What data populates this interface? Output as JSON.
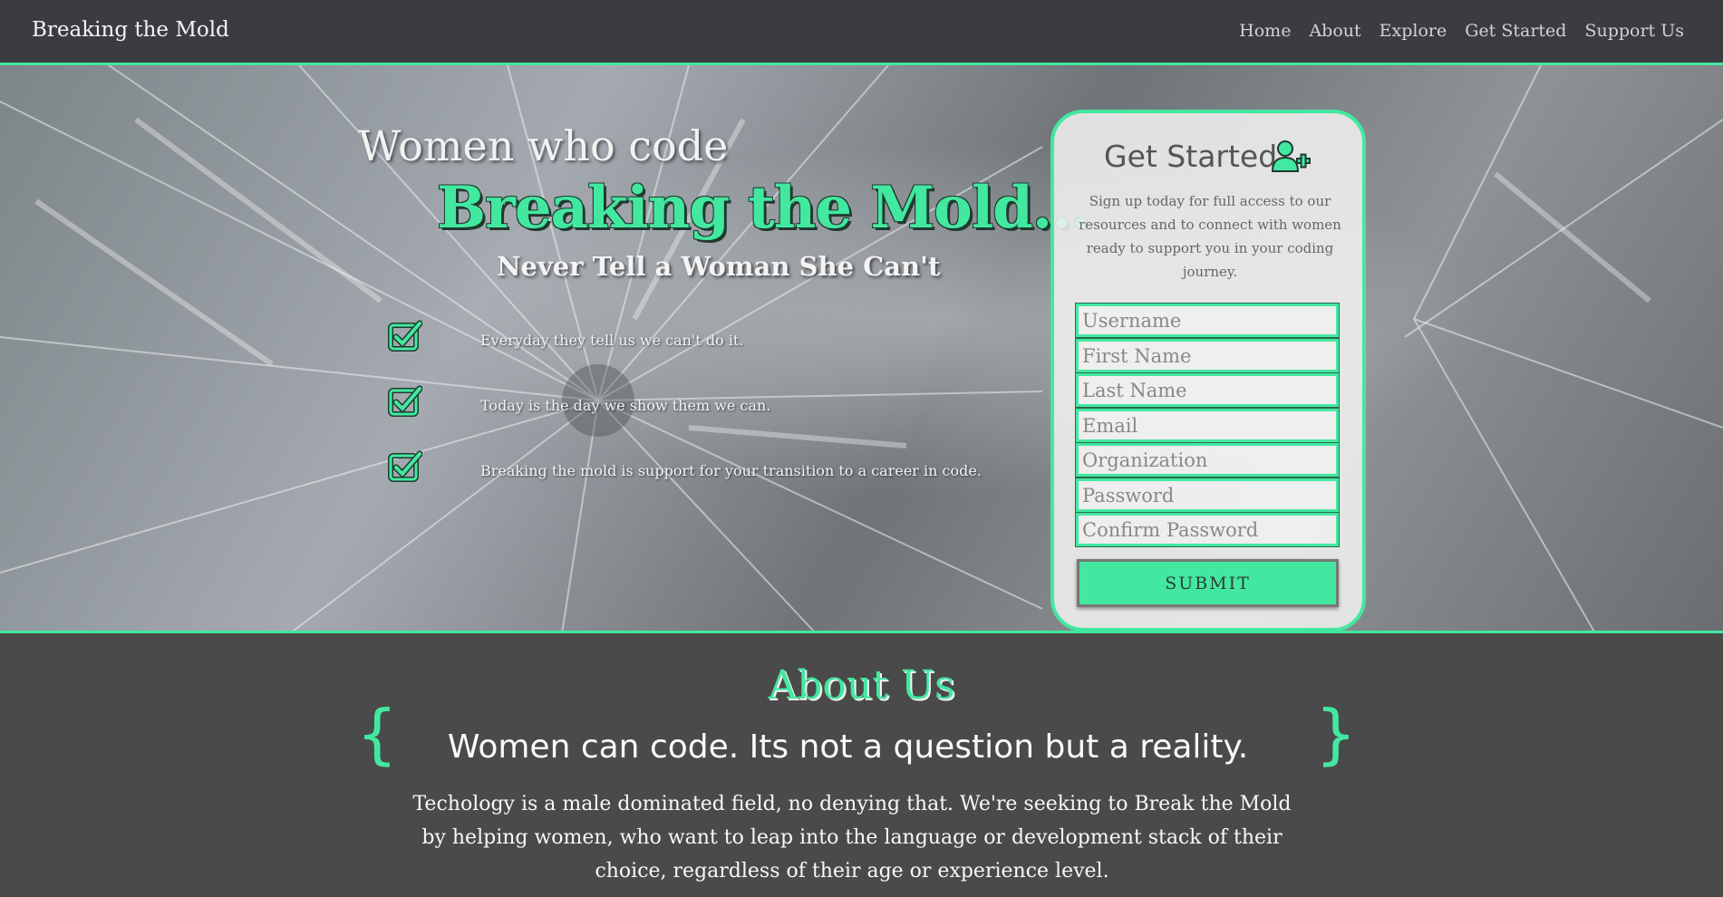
{
  "nav": {
    "brand": "Breaking the Mold",
    "links": [
      "Home",
      "About",
      "Explore",
      "Get Started",
      "Support Us"
    ]
  },
  "hero": {
    "subtitle": "Women who code",
    "title": "Breaking the Mold...",
    "tagline": "Never Tell a Woman She Can't",
    "checklist": [
      "Everyday they tell us we can't do it.",
      "Today is the day we show them we can.",
      "Breaking the mold is support for your transition to a career in code."
    ]
  },
  "signup": {
    "title": "Get Started",
    "description": "Sign up today for full access to our resources and to connect with women ready to support you in your coding journey.",
    "placeholders": {
      "username": "Username",
      "first_name": "First Name",
      "last_name": "Last Name",
      "email": "Email",
      "organization": "Organization",
      "password": "Password",
      "confirm_password": "Confirm Password"
    },
    "submit_label": "SUBMIT"
  },
  "about": {
    "title": "About Us",
    "left_brace": "{",
    "right_brace": "}",
    "heading": "Women can code. Its not a question but a reality.",
    "body": "Techology is a male dominated field, no denying that. We're seeking to Break the Mold by helping women, who want to leap into the language or development stack of their choice, regardless of their age or experience level."
  },
  "colors": {
    "accent": "#43e8a0",
    "nav_bg": "#3a3c40",
    "about_bg": "#4a4a4a"
  },
  "icons": [
    "check-square-icon",
    "user-plus-icon"
  ]
}
